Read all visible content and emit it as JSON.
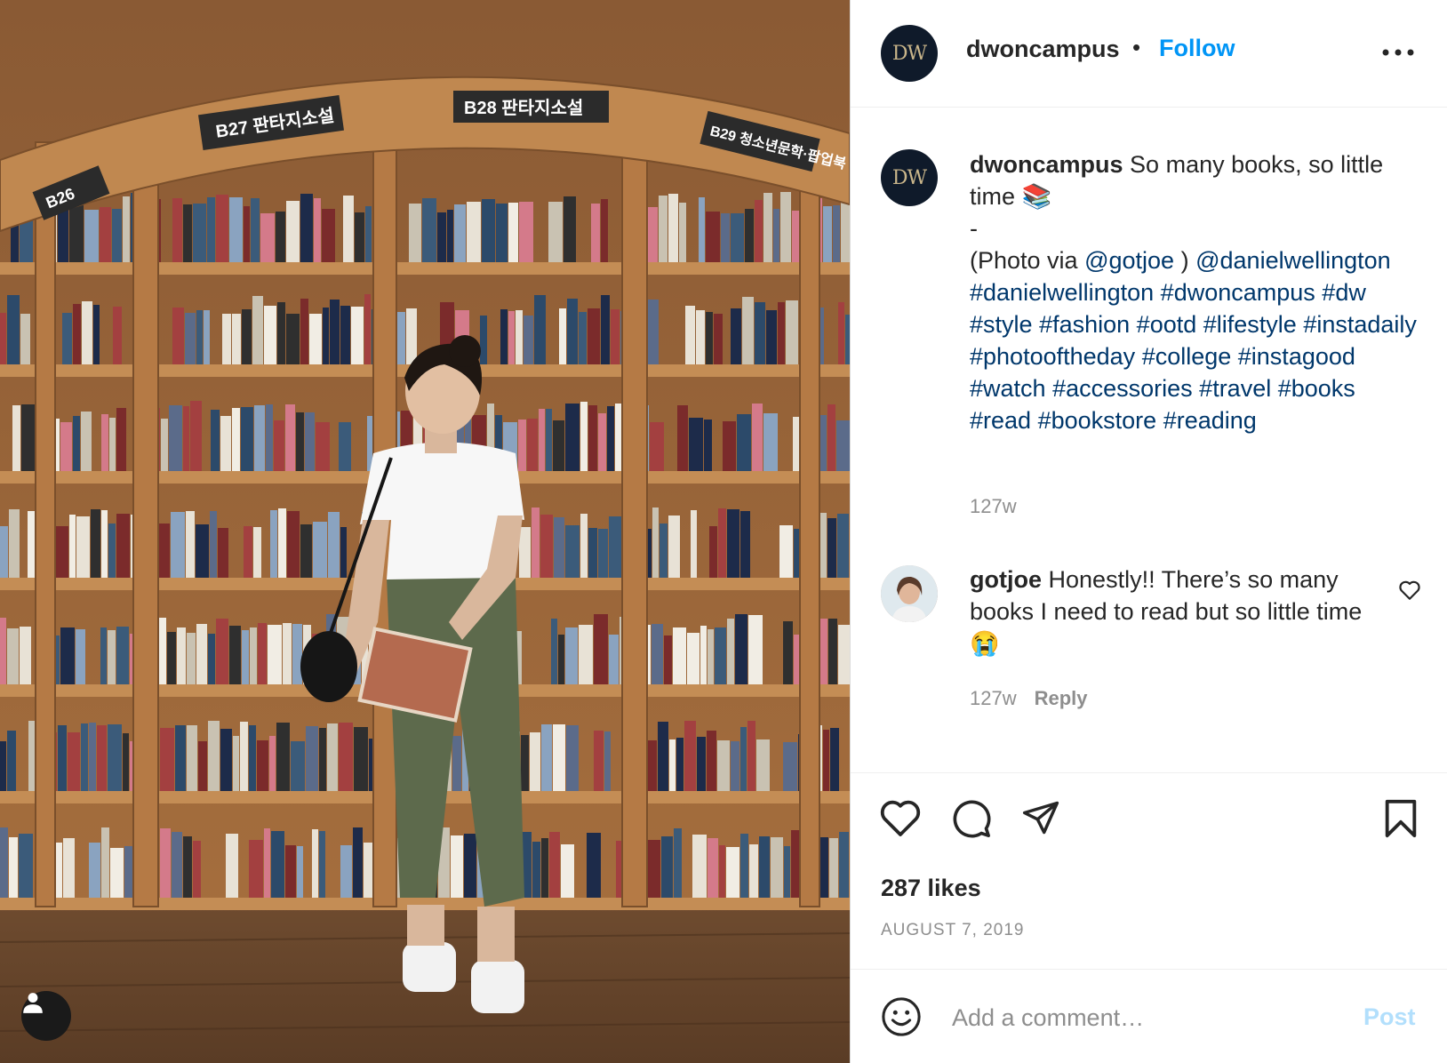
{
  "post": {
    "username": "dwoncampus",
    "avatar_text": "DW",
    "follow_label": "Follow",
    "separator": "•"
  },
  "caption": {
    "username": "dwoncampus",
    "line1": "So many books, so little time",
    "emoji_books": "📚",
    "dash": "-",
    "photo_via": "(Photo via",
    "mention_gotjoe": "@gotjoe",
    "close_paren": ")",
    "mention_dw": "@danielwellington",
    "hashtags": [
      "#danielwellington",
      "#dwoncampus",
      "#dw",
      "#style",
      "#fashion",
      "#ootd",
      "#lifestyle",
      "#instadaily",
      "#photooftheday",
      "#college",
      "#instagood",
      "#watch",
      "#accessories",
      "#travel",
      "#books",
      "#read",
      "#bookstore",
      "#reading"
    ],
    "time": "127w"
  },
  "comment": {
    "username": "gotjoe",
    "text": "Honestly!! There’s so many books I need to read but so little time",
    "emoji": "😭",
    "time": "127w",
    "reply_label": "Reply"
  },
  "actions": {
    "likes": "287 likes",
    "date": "AUGUST 7, 2019"
  },
  "comment_box": {
    "placeholder": "Add a comment…",
    "post_label": "Post"
  },
  "photo": {
    "shelf_labels": [
      "B26",
      "B27 판타지소설",
      "B28 판타지소설",
      "B29 청소년문학·팝업북"
    ]
  },
  "colors": {
    "link": "#00376b",
    "follow": "#0095f6",
    "muted": "#8e8e8e",
    "post_disabled": "#b2dffc"
  }
}
